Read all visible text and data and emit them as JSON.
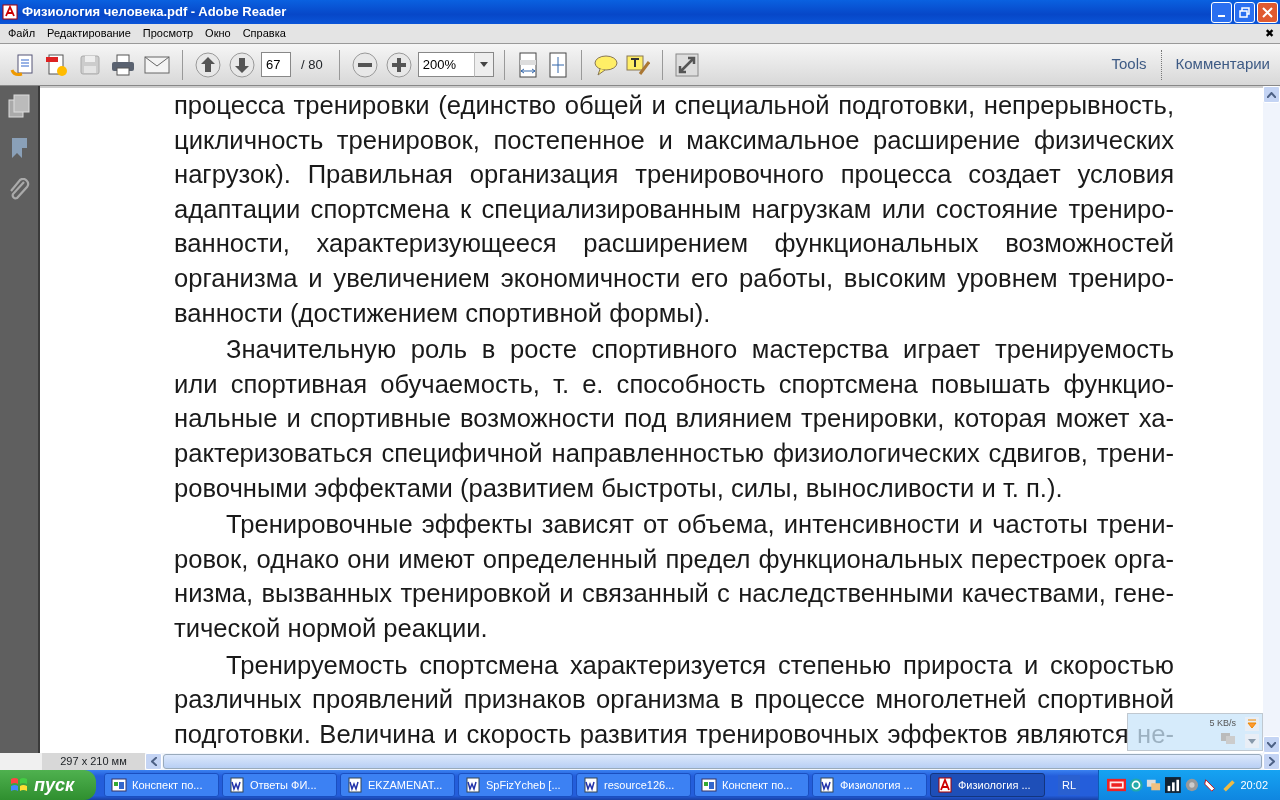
{
  "window": {
    "title": "Физиология человека.pdf - Adobe Reader"
  },
  "menu": [
    "Файл",
    "Редактирование",
    "Просмотр",
    "Окно",
    "Справка"
  ],
  "menu_close": "✖",
  "toolbar": {
    "page": "67",
    "page_total": "/ 80",
    "zoom": "200%",
    "tools": "Tools",
    "comments": "Комментарии"
  },
  "document": {
    "paragraphs": [
      {
        "indented": false,
        "ends_on_page": true,
        "lines": [
          "процесса тренировки (единство общей и специальной подготовки, непрерывность,",
          "цикличность тренировок, постепенное и максимальное расширение физических",
          "нагрузок). Правильная организация тренировочного процесса создает условия",
          "адаптации спортсмена к специализированным нагрузкам или состояние трениро-",
          "ванности, характеризующееся расширением функциональных возможностей",
          "организма и увеличением экономичности его работы, высоким уровнем трениро-",
          "ванности (достижением спортивной формы)."
        ]
      },
      {
        "indented": true,
        "ends_on_page": true,
        "lines": [
          "Значительную роль в росте спортивного мастерства играет тренируемость",
          "или спортивная обучаемость, т. е. способность спортсмена повышать функцио-",
          "нальные и спортивные возможности под влиянием тренировки, которая может ха-",
          "рактеризоваться специфичной направленностью физиологических сдвигов, трени-",
          "ровочными эффектами (развитием быстроты, силы, выносливости и т. п.)."
        ]
      },
      {
        "indented": true,
        "ends_on_page": true,
        "lines": [
          "Тренировочные эффекты зависят от объема, интенсивности и частоты трени-",
          "ровок, однако они имеют определенный предел функциональных перестроек орга-",
          "низма, вызванных тренировкой и связанный с наследственными качествами, гене-",
          "тической нормой реакции."
        ]
      },
      {
        "indented": true,
        "ends_on_page": false,
        "lines": [
          "Тренируемость спортсмена характеризуется степенью прироста и скоростью",
          "различных проявлений признаков организма в процессе многолетней спортивной",
          "подготовки. Величина и скорость развития тренировочных эффектов являются не-"
        ]
      }
    ]
  },
  "page_size": "297 x 210 мм",
  "net_widget": {
    "speed": "5 KB/s"
  },
  "taskbar": {
    "start": "пуск",
    "items": [
      {
        "label": "Конспект по...",
        "kind": "app",
        "selected": false
      },
      {
        "label": "Ответы ФИ...",
        "kind": "word",
        "selected": false
      },
      {
        "label": "EKZAMENAT...",
        "kind": "word",
        "selected": false
      },
      {
        "label": "SpFizYcheb [...",
        "kind": "word",
        "selected": false
      },
      {
        "label": "resource126...",
        "kind": "word",
        "selected": false
      },
      {
        "label": "Конспект по...",
        "kind": "app",
        "selected": false
      },
      {
        "label": "Физиология ...",
        "kind": "word",
        "selected": false
      },
      {
        "label": "Физиология ...",
        "kind": "pdf",
        "selected": true
      }
    ],
    "language": "RL",
    "clock": "20:02"
  }
}
